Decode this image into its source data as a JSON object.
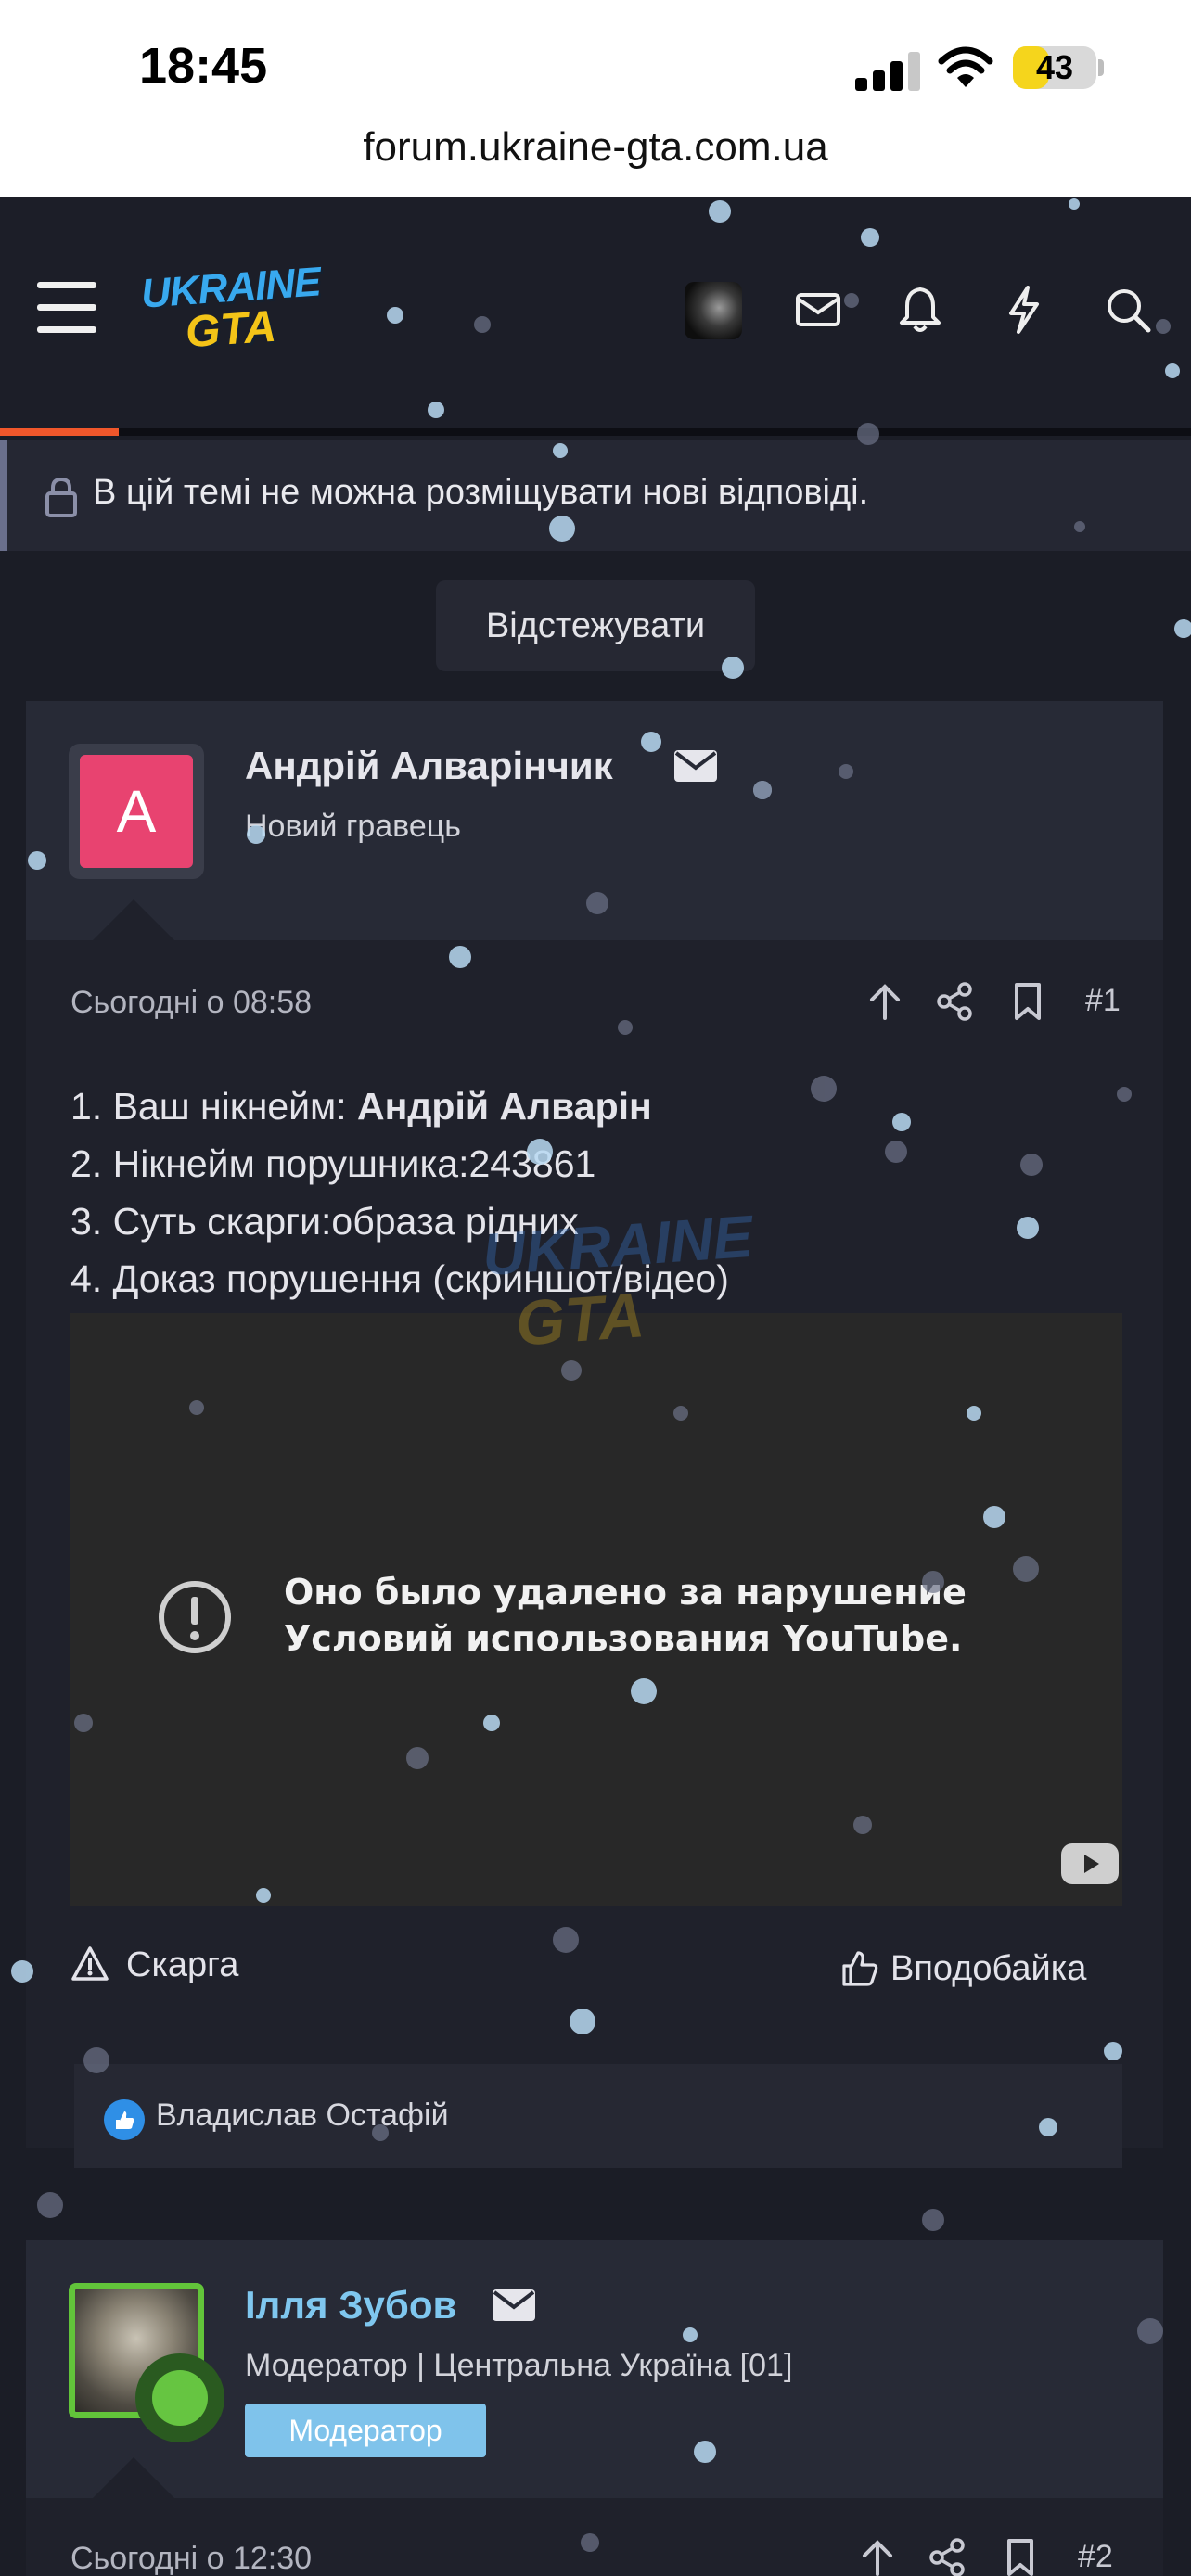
{
  "status_bar": {
    "time": "18:45",
    "battery": "43",
    "battery_level": 0.43
  },
  "browser": {
    "url": "forum.ukraine-gta.com.ua"
  },
  "header": {
    "logo_top": "UKRAINE",
    "logo_bottom": "GTA",
    "icons": [
      "menu-icon",
      "avatar",
      "mail-icon",
      "bell-icon",
      "lightning-icon",
      "search-icon"
    ],
    "reading_progress": 0.1
  },
  "notice": {
    "text": "В цій темі не можна розміщувати нові відповіді.",
    "icon": "lock-icon"
  },
  "watch_button": "Відстежувати",
  "posts": [
    {
      "avatar_letter": "A",
      "author": "Андрій Алварінчик",
      "title": "Новий гравець",
      "date": "Сьогодні о 08:58",
      "number": "#1",
      "body": [
        {
          "prefix": "1. Ваш нікнейм: ",
          "bold": "Андрій Алварін"
        },
        {
          "prefix": "2. Нікнейм порушника:243861"
        },
        {
          "prefix": "3. Суть скарги:образа рідних"
        },
        {
          "prefix": "4. Доказ порушення (скриншот/відео)"
        }
      ],
      "video_message": [
        "Оно было удалено за нарушение",
        "Условий использования YouTube."
      ],
      "report": "Скарга",
      "like": "Вподобайка",
      "reactions": "Владислав Остафій"
    },
    {
      "author": "Ілля Зубов",
      "title": "Модератор | Центральна Україна [01]",
      "badge": "Модератор",
      "date": "Сьогодні о 12:30",
      "number": "#2"
    }
  ],
  "watermark": {
    "top": "UKRAINE",
    "bottom": "GTA"
  },
  "colors": {
    "accent": "#f0572b",
    "moderator": "#7fc7ef",
    "avatar_pink": "#e84370",
    "logo_blue": "#38a9ef",
    "logo_yellow": "#f3c418"
  }
}
